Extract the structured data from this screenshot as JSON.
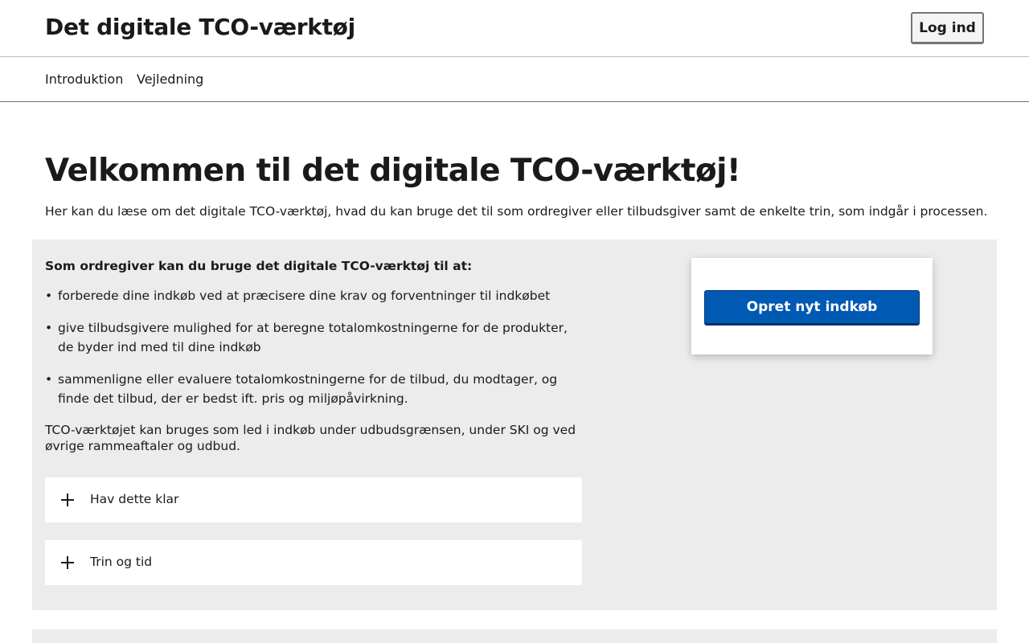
{
  "header": {
    "site_title": "Det digitale TCO-værktøj",
    "login_label": "Log ind"
  },
  "nav": {
    "items": [
      {
        "label": "Introduktion"
      },
      {
        "label": "Vejledning"
      }
    ]
  },
  "main": {
    "title": "Velkommen til det digitale TCO-værktøj!",
    "lead": "Her kan du læse om det digitale TCO-værktøj, hvad du kan bruge det til som ordregiver eller tilbudsgiver samt de enkelte trin, som indgår i processen.",
    "intro_heading": "Som ordregiver kan du bruge det digitale TCO-værktøj til at:",
    "bullets": [
      "forberede dine indkøb ved at præcisere dine krav og forventninger til indkøbet",
      "give tilbudsgivere mulighed for at beregne totalomkostningerne for de produkter, de byder ind med til dine indkøb",
      "sammenligne eller evaluere totalomkostningerne for de tilbud, du modtager, og finde det tilbud, der er bedst ift. pris og miljøpåvirkning."
    ],
    "usage_note": "TCO-værktøjet kan bruges som led i indkøb under udbudsgrænsen, under SKI og ved øvrige rammeaftaler og udbud.",
    "accordions": [
      {
        "label": "Hav dette klar"
      },
      {
        "label": "Trin og tid"
      }
    ],
    "create_button_label": "Opret nyt indkøb"
  },
  "colors": {
    "primary": "#0059b3",
    "panel_bg": "#ececec"
  }
}
